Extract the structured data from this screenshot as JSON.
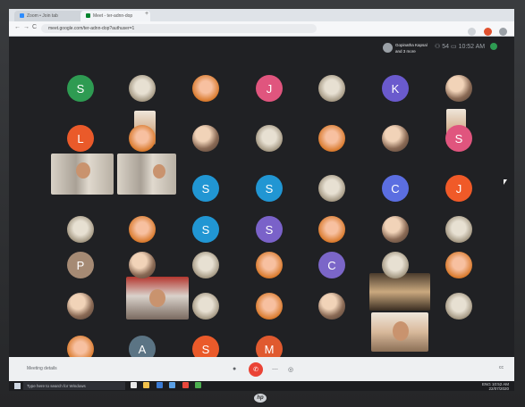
{
  "browser": {
    "tab1_title": "Zoom • Join tab",
    "tab2_title": "Meet - ter-adnn-dop",
    "new_tab": "+",
    "url": "meet.google.com/ter-adnn-dop?authuser=1",
    "back": "←",
    "forward": "→",
    "reload": "C"
  },
  "meet": {
    "host_name": "Gopinatha Kapsal and 3 more",
    "meeting_label": "Meeting details",
    "end_call_icon": "✆",
    "more_options": "⋯",
    "captions_icon": "cc",
    "participants_count": "54",
    "time": "10:52 AM"
  },
  "participants": [
    {
      "label": "S",
      "color": "#2e9b52"
    },
    {
      "label": "",
      "color": "#7f6a55"
    },
    {
      "label": "",
      "color": "#d9d4df"
    },
    {
      "label": "J",
      "color": "#e0557e"
    },
    {
      "label": "",
      "color": "#d8d4d0"
    },
    {
      "label": "K",
      "color": "#6a5acd"
    },
    {
      "label": "",
      "color": "#c9b8a6"
    },
    {
      "label": "L",
      "color": "#ea5a2a"
    },
    {
      "label": "",
      "color": "#b9b9c2"
    },
    {
      "label": "",
      "color": "#5d6f88"
    },
    {
      "label": "",
      "color": "#c0c7d2"
    },
    {
      "label": "",
      "color": "#e7a53a"
    },
    {
      "label": "",
      "color": "#cfc6b8"
    },
    {
      "label": "S",
      "color": "#e0557e"
    },
    {
      "label": "S",
      "color": "#2196d3"
    },
    {
      "label": "S",
      "color": "#2196d3"
    },
    {
      "label": "",
      "color": "#e06a22"
    },
    {
      "label": "C",
      "color": "#5b6ee1"
    },
    {
      "label": "J",
      "color": "#f05a28"
    },
    {
      "label": "",
      "color": "#d8b7a2"
    },
    {
      "label": "",
      "color": "#e1b897"
    },
    {
      "label": "S",
      "color": "#2196d3"
    },
    {
      "label": "S",
      "color": "#7a62c9"
    },
    {
      "label": "",
      "color": "#d8c2b0"
    },
    {
      "label": "",
      "color": "#7f97b8"
    },
    {
      "label": "",
      "color": "#b04a3e"
    },
    {
      "label": "P",
      "color": "#a58a74"
    },
    {
      "label": "",
      "color": "#e2dcd3"
    },
    {
      "label": "",
      "color": "#8f8171"
    },
    {
      "label": "",
      "color": "#0e0e10"
    },
    {
      "label": "C",
      "color": "#7b66c8"
    },
    {
      "label": "",
      "color": "#d7c2b0"
    },
    {
      "label": "",
      "color": "#cbb7c3"
    },
    {
      "label": "",
      "color": "#e1dbe6"
    },
    {
      "label": "",
      "color": "#ccb8a6"
    },
    {
      "label": "",
      "color": "#b7b79a"
    },
    {
      "label": "",
      "color": "#c8a48b"
    },
    {
      "label": "",
      "color": "#a7b1a0"
    },
    {
      "label": "",
      "color": "#7a9a86"
    },
    {
      "label": "A",
      "color": "#5b7484"
    },
    {
      "label": "S",
      "color": "#ea5a2a"
    },
    {
      "label": "M",
      "color": "#e05a2f"
    }
  ],
  "taskbar": {
    "search_placeholder": "Type here to search for Windows",
    "tray_time": "10:52 AM",
    "tray_date": "22/07/2020",
    "lang": "ENG"
  },
  "monitor_brand": "hp"
}
